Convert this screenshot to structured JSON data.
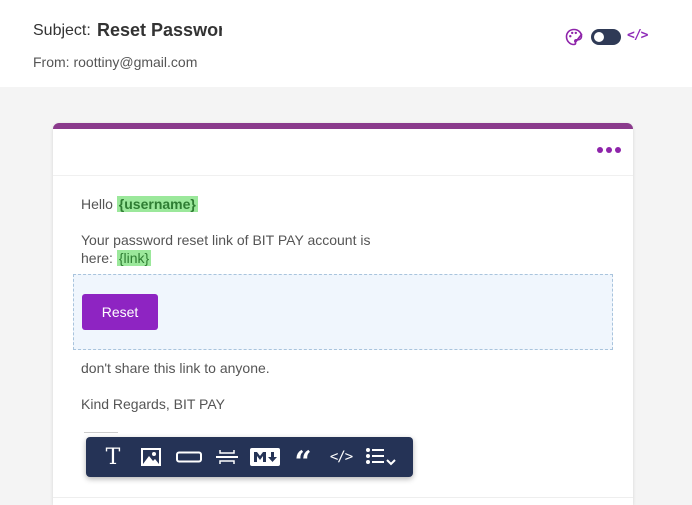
{
  "header": {
    "subject_label": "Subject:",
    "subject_value": "Reset Password",
    "from_label": "From:",
    "from_email": "roottiny@gmail.com",
    "accent_color": "#8e24aa",
    "icons": [
      "palette-icon",
      "toggle-switch",
      "code-icon"
    ],
    "code_icon_text": "</>"
  },
  "email": {
    "greeting": "Hello",
    "username_tag": "{username}",
    "body_line1": "Your password reset link of BIT PAY account is",
    "body_line2": "here:",
    "link_tag": "{link}",
    "button_label": "Reset",
    "warning": "don't share this link to anyone.",
    "signoff": "Kind Regards, BIT PAY",
    "card_border_color": "#8a3a8c",
    "button_color": "#8e24c2",
    "tag_color": "#9be89b"
  },
  "toolbar": {
    "items": [
      "text-icon",
      "image-icon",
      "button-icon",
      "divider-icon",
      "markdown-icon",
      "quote-icon",
      "code-icon",
      "list-icon"
    ],
    "background": "#253356",
    "code_label": "</>"
  }
}
